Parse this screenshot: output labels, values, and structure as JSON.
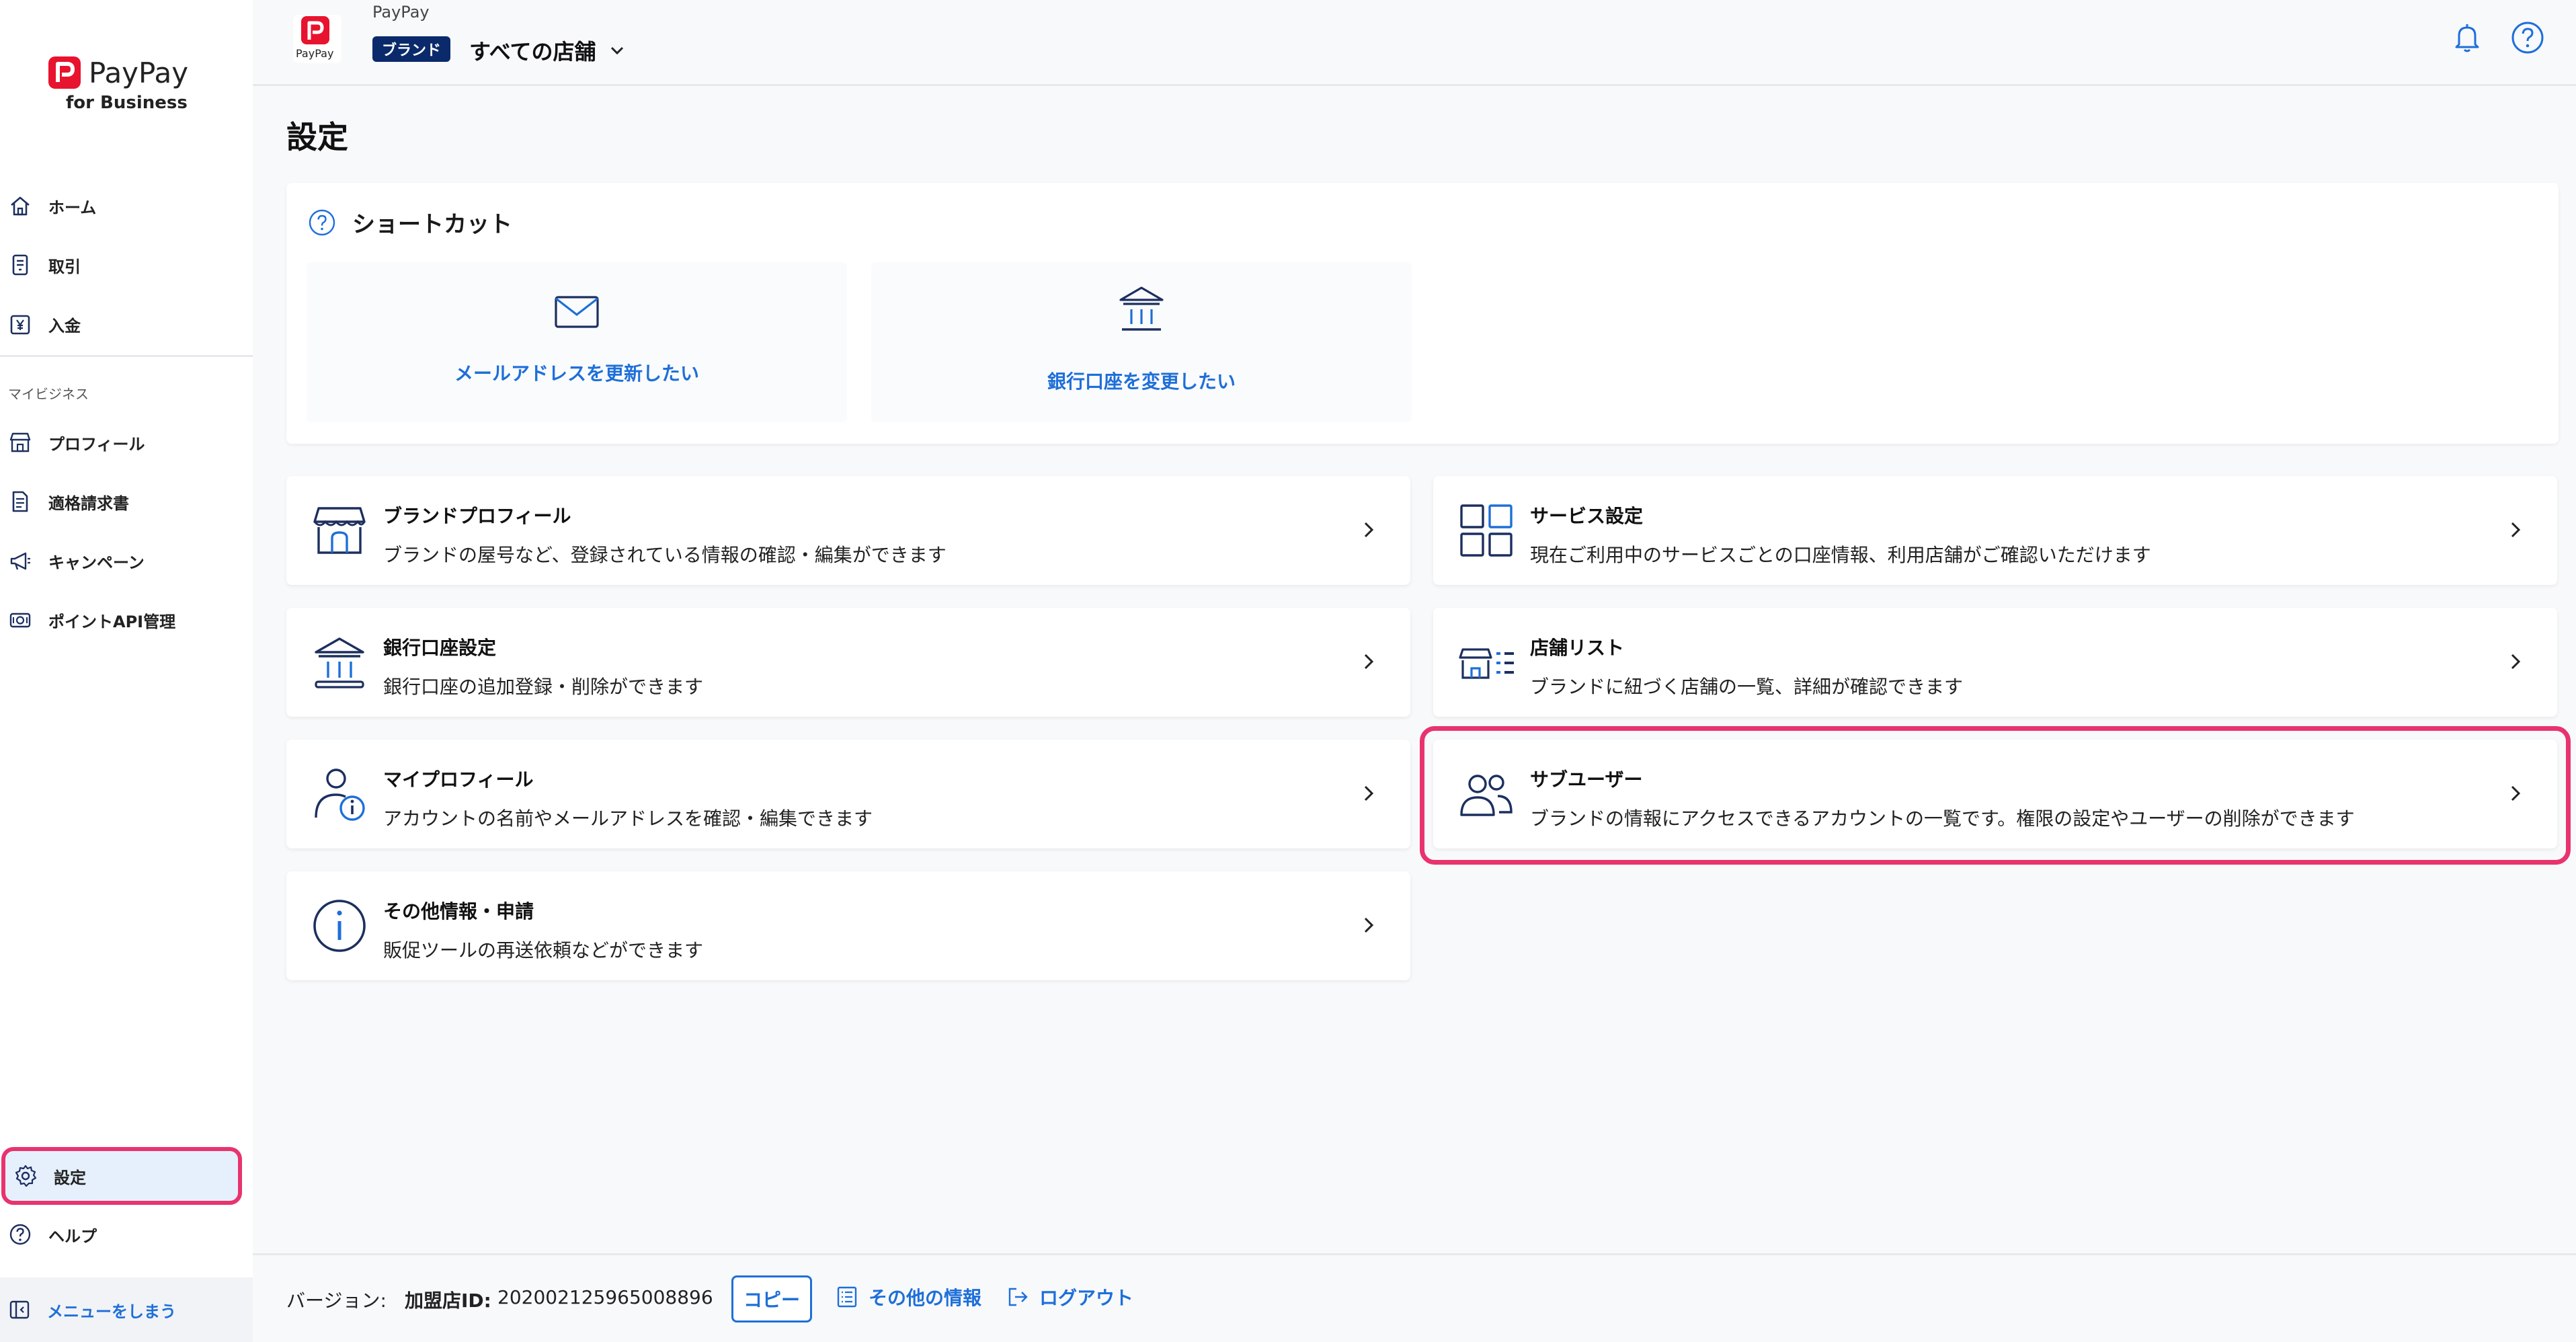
{
  "app": {
    "logo_text": "PayPay",
    "logo_sub": "for Business",
    "header_logo_text": "PayPay",
    "header_app_name": "PayPay",
    "brand_badge": "ブランド",
    "store_selector": "すべての店舗"
  },
  "colors": {
    "accent": "#1e6fd9",
    "brand_red": "#e8132e",
    "badge_navy": "#0a2a6b",
    "highlight_pink": "#e8336e",
    "icon_navy": "#1c2f5f"
  },
  "sidebar": {
    "items": [
      {
        "label": "ホーム",
        "icon": "home-icon"
      },
      {
        "label": "取引",
        "icon": "receipt-icon"
      },
      {
        "label": "入金",
        "icon": "deposit-icon"
      }
    ],
    "section_label": "マイビジネス",
    "business_items": [
      {
        "label": "プロフィール",
        "icon": "store-icon"
      },
      {
        "label": "適格請求書",
        "icon": "document-icon"
      },
      {
        "label": "キャンペーン",
        "icon": "megaphone-icon"
      },
      {
        "label": "ポイントAPI管理",
        "icon": "point-api-icon"
      }
    ],
    "bottom_items": [
      {
        "label": "設定",
        "icon": "gear-icon",
        "active": true
      },
      {
        "label": "ヘルプ",
        "icon": "help-icon"
      }
    ],
    "collapse_label": "メニューをしまう"
  },
  "page": {
    "title": "設定"
  },
  "shortcuts": {
    "title": "ショートカット",
    "items": [
      {
        "label": "メールアドレスを更新したい",
        "icon": "mail-icon"
      },
      {
        "label": "銀行口座を変更したい",
        "icon": "bank-icon"
      }
    ]
  },
  "settings": {
    "left": [
      {
        "title": "ブランドプロフィール",
        "desc": "ブランドの屋号など、登録されている情報の確認・編集ができます",
        "icon": "store-icon"
      },
      {
        "title": "銀行口座設定",
        "desc": "銀行口座の追加登録・削除ができます",
        "icon": "bank-icon"
      },
      {
        "title": "マイプロフィール",
        "desc": "アカウントの名前やメールアドレスを確認・編集できます",
        "icon": "user-info-icon"
      },
      {
        "title": "その他情報・申請",
        "desc": "販促ツールの再送依頼などができます",
        "icon": "info-icon"
      }
    ],
    "right": [
      {
        "title": "サービス設定",
        "desc": "現在ご利用中のサービスごとの口座情報、利用店舗がご確認いただけます",
        "icon": "grid-icon"
      },
      {
        "title": "店舗リスト",
        "desc": "ブランドに紐づく店舗の一覧、詳細が確認できます",
        "icon": "store-list-icon"
      },
      {
        "title": "サブユーザー",
        "desc": "ブランドの情報にアクセスできるアカウントの一覧です。権限の設定やユーザーの削除ができます",
        "icon": "users-icon"
      }
    ]
  },
  "footer": {
    "version_label": "バージョン:",
    "merchant_id_label": "加盟店ID:",
    "merchant_id": "202002125965008896",
    "copy_label": "コピー",
    "other_info_label": "その他の情報",
    "logout_label": "ログアウト"
  }
}
